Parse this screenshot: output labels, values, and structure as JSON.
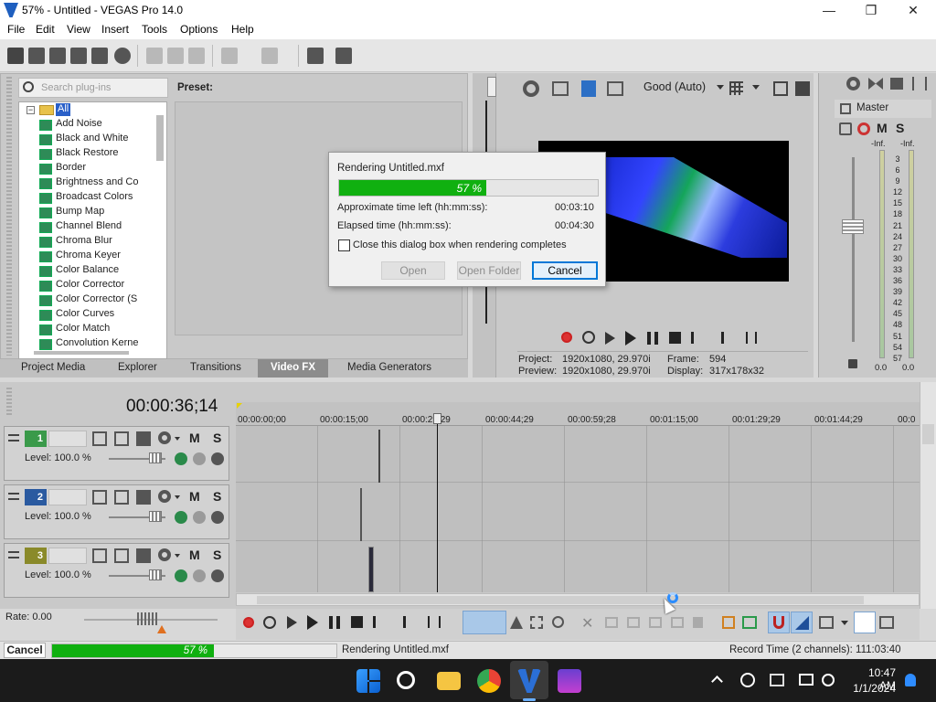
{
  "window": {
    "title": "57% - Untitled - VEGAS Pro 14.0",
    "minimize": "—",
    "maximize": "❐",
    "close": "✕"
  },
  "menu": [
    "File",
    "Edit",
    "View",
    "Insert",
    "Tools",
    "Options",
    "Help"
  ],
  "plugins": {
    "search_placeholder": "Search plug-ins",
    "preset_label": "Preset:",
    "root": "All",
    "items": [
      "Add Noise",
      "Black and White",
      "Black Restore",
      "Border",
      "Brightness and Co",
      "Broadcast Colors",
      "Bump Map",
      "Channel Blend",
      "Chroma Blur",
      "Chroma Keyer",
      "Color Balance",
      "Color Corrector",
      "Color Corrector (S",
      "Color Curves",
      "Color Match",
      "Convolution Kerne"
    ]
  },
  "tabs": [
    "Project Media",
    "Explorer",
    "Transitions",
    "Video FX",
    "Media Generators"
  ],
  "active_tab": "Video FX",
  "preview": {
    "quality": "Good (Auto)",
    "project_label": "Project:",
    "project_value": "1920x1080, 29.970i",
    "preview_label": "Preview:",
    "preview_value": "1920x1080, 29.970i",
    "frame_label": "Frame:",
    "frame_value": "594",
    "display_label": "Display:",
    "display_value": "317x178x32"
  },
  "master": {
    "title": "Master",
    "mute": "M",
    "solo": "S",
    "inf_left": "-Inf.",
    "inf_right": "-Inf.",
    "scale": [
      "3",
      "6",
      "9",
      "12",
      "15",
      "18",
      "21",
      "24",
      "27",
      "30",
      "33",
      "36",
      "39",
      "42",
      "45",
      "48",
      "51",
      "54",
      "57"
    ],
    "level_left": "0.0",
    "level_right": "0.0"
  },
  "dialog": {
    "title": "Rendering Untitled.mxf",
    "progress_text": "57 %",
    "progress": 0.57,
    "time_left_label": "Approximate time left (hh:mm:ss):",
    "time_left_value": "00:03:10",
    "elapsed_label": "Elapsed time (hh:mm:ss):",
    "elapsed_value": "00:04:30",
    "checkbox_label": "Close this dialog box when rendering completes",
    "open_btn": "Open",
    "open_folder_btn": "Open Folder",
    "cancel_btn": "Cancel"
  },
  "timeline": {
    "timecode": "00:00:36;14",
    "ruler": [
      "00:00:00;00",
      "00:00:15;00",
      "00:00:29;29",
      "00:00:44;29",
      "00:00:59;28",
      "00:01:15;00",
      "00:01:29;29",
      "00:01:44;29",
      "00:0"
    ],
    "tracks": [
      {
        "num": "1",
        "level": "Level: 100.0 %",
        "mute": "M",
        "solo": "S"
      },
      {
        "num": "2",
        "level": "Level: 100.0 %",
        "mute": "M",
        "solo": "S"
      },
      {
        "num": "3",
        "level": "Level: 100.0 %",
        "mute": "M",
        "solo": "S"
      }
    ],
    "rate": "Rate: 0.00"
  },
  "status": {
    "cancel": "Cancel",
    "progress_text": "57 %",
    "progress": 0.57,
    "message": "Rendering Untitled.mxf",
    "record_time": "Record Time (2 channels): 111:03:40"
  },
  "taskbar": {
    "time": "10:47 AM",
    "date": "1/1/2024"
  },
  "colors": {
    "progress_green": "#10b010",
    "accent_blue": "#0078d7",
    "taskbar": "#1b1b1b"
  }
}
